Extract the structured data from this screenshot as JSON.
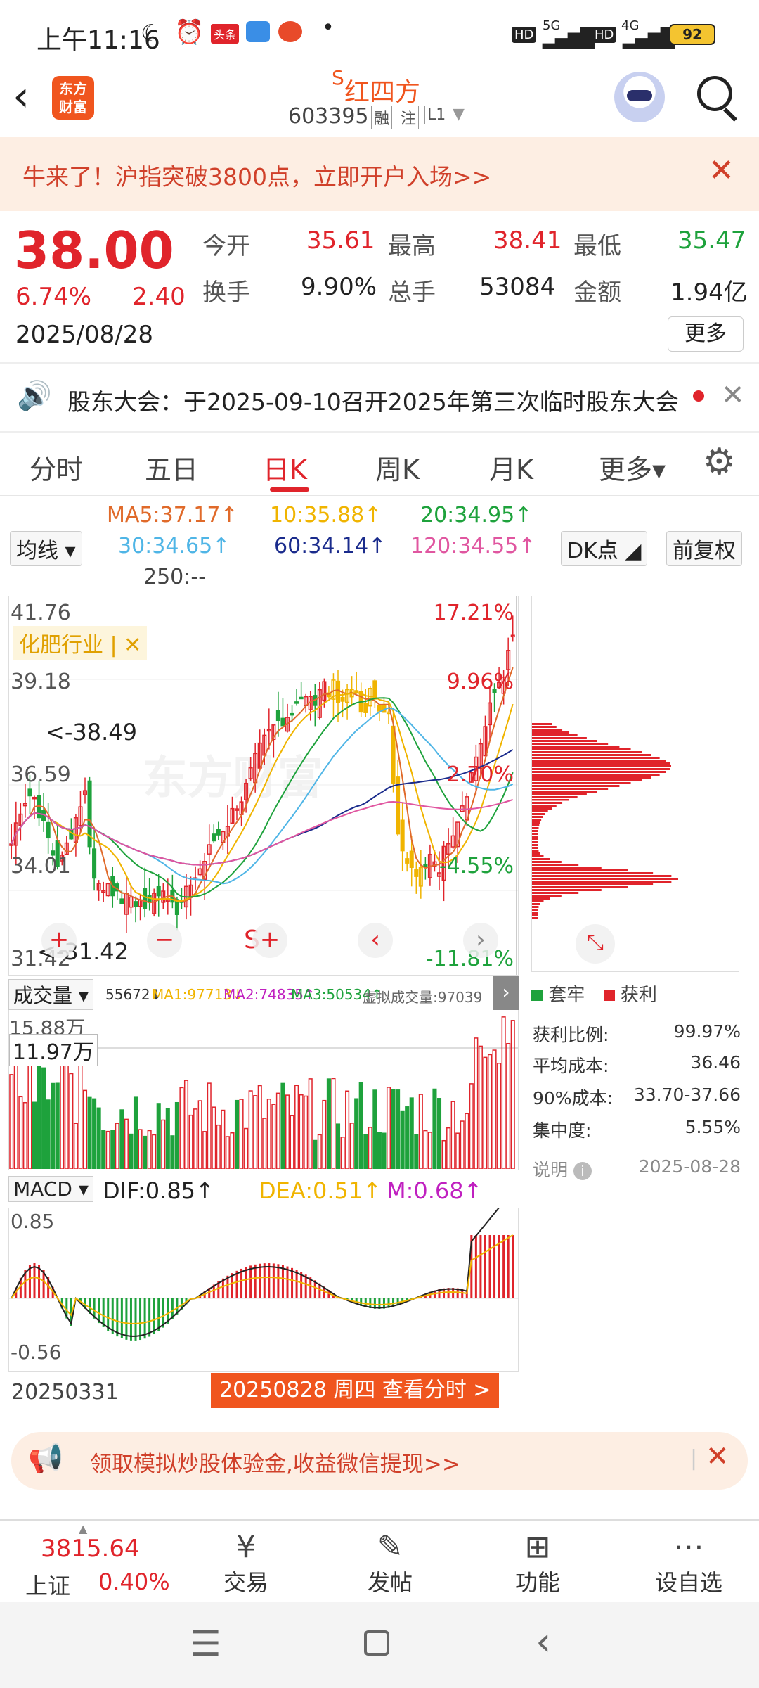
{
  "status": {
    "time": "上午11:16",
    "network_5g": "5G",
    "network_4g": "4G",
    "hd1": "HD",
    "hd2": "HD",
    "battery": "92",
    "app_badge": "头条"
  },
  "header": {
    "logo_text_line1": "东方",
    "logo_text_line2": "财富",
    "s_mark": "S",
    "stock_name": "红四方",
    "stock_code": "603395",
    "tag_margin": "融",
    "tag_watch": "注",
    "tag_level": "L1"
  },
  "banner": {
    "text": "牛来了！沪指突破3800点，立即开户入场>>"
  },
  "quote": {
    "price": "38.00",
    "change_pct": "6.74%",
    "change_amt": "2.40",
    "date": "2025/08/28",
    "open_label": "今开",
    "open_value": "35.61",
    "high_label": "最高",
    "high_value": "38.41",
    "low_label": "最低",
    "low_value": "35.47",
    "turnover_label": "换手",
    "turnover_value": "9.90%",
    "volume_label": "总手",
    "volume_value": "53084",
    "amount_label": "金额",
    "amount_value": "1.94亿",
    "more_button": "更多"
  },
  "notice": {
    "text": "股东大会：于2025-09-10召开2025年第三次临时股东大会"
  },
  "tabs": [
    "分时",
    "五日",
    "日K",
    "周K",
    "月K",
    "更多▾"
  ],
  "ma": {
    "ma5": "MA5:37.17↑",
    "ma10": "10:35.88↑",
    "ma20": "20:34.95↑",
    "ma30": "30:34.65↑",
    "ma60": "60:34.14↑",
    "ma120": "120:34.55↑",
    "ma250": "250:--",
    "selector": "均线",
    "dk": "DK点",
    "adjust": "前复权"
  },
  "chart": {
    "y_top": "41.76",
    "y_2": "39.18",
    "y_3": "36.59",
    "y_4": "34.01",
    "y_bottom": "31.42",
    "pct_top": "17.21%",
    "pct_2": "9.96%",
    "pct_3": "2.70%",
    "pct_4": "-4.55%",
    "pct_bottom": "-11.81%",
    "high_mark": "<-38.49",
    "low_mark": "<-31.42",
    "industry_tag": "化肥行业 | ✕",
    "watermark": "东方财富"
  },
  "chip": {
    "legend_trapped": "套牢",
    "legend_profit": "获利",
    "profit_ratio_label": "获利比例:",
    "profit_ratio_value": "99.97%",
    "avg_cost_label": "平均成本:",
    "avg_cost_value": "36.46",
    "cost90_label": "90%成本:",
    "cost90_value": "33.70-37.66",
    "concentration_label": "集中度:",
    "concentration_value": "5.55%",
    "explain_label": "说明",
    "date": "2025-08-28"
  },
  "volume": {
    "selector": "成交量",
    "vol": "55672↓",
    "ma1": "MA1:97713↓",
    "ma2": "MA2:74835↑",
    "ma3": "MA3:50534↑",
    "virtual": "虚拟成交量:97039",
    "y_top": "15.88万",
    "cursor_value": "11.97万"
  },
  "macd": {
    "selector": "MACD",
    "dif": "DIF:0.85↑",
    "dea": "DEA:0.51↑",
    "m": "M:0.68↑",
    "y_top": "0.85",
    "y_bottom": "-0.56",
    "date_start": "20250331",
    "date_cursor": "20250828 周四 查看分时 >"
  },
  "promo": {
    "text": "领取模拟炒股体验金,收益微信提现>>"
  },
  "bottom_nav": {
    "index_value": "3815.64",
    "index_name": "上证",
    "index_pct": "0.40%",
    "trade": "交易",
    "post": "发帖",
    "features": "功能",
    "add_watch": "设自选"
  },
  "colors": {
    "up": "#e0242b",
    "down": "#1ea23c",
    "accent": "#f0551e",
    "ma5": "#e06a2a",
    "ma10": "#f0b400",
    "ma20": "#1ea23c",
    "ma30": "#4fb5e6",
    "ma60": "#1a2b8c",
    "ma120": "#e056a0"
  }
}
